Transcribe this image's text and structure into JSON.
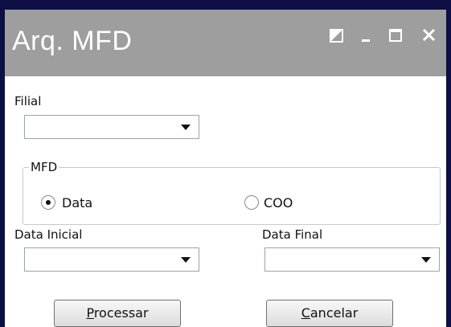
{
  "window": {
    "title": "Arq. MFD",
    "controls": {
      "restore_icon": "restore-icon",
      "minimize_icon": "minimize-icon",
      "maximize_icon": "maximize-icon",
      "close_icon": "close-icon"
    }
  },
  "form": {
    "filial": {
      "label": "Filial",
      "value": ""
    },
    "mfd_group": {
      "legend": "MFD",
      "options": [
        {
          "label": "Data",
          "selected": true
        },
        {
          "label": "COO",
          "selected": false
        }
      ]
    },
    "data_inicial": {
      "label": "Data Inicial",
      "value": ""
    },
    "data_final": {
      "label": "Data Final",
      "value": ""
    },
    "buttons": {
      "processar": {
        "mnemonic": "P",
        "rest": "rocessar"
      },
      "cancelar": {
        "mnemonic": "C",
        "rest": "ancelar"
      }
    }
  },
  "colors": {
    "frame": "#0d0f44",
    "titlebar": "#9e9e9e",
    "title_text": "#ffffff"
  }
}
